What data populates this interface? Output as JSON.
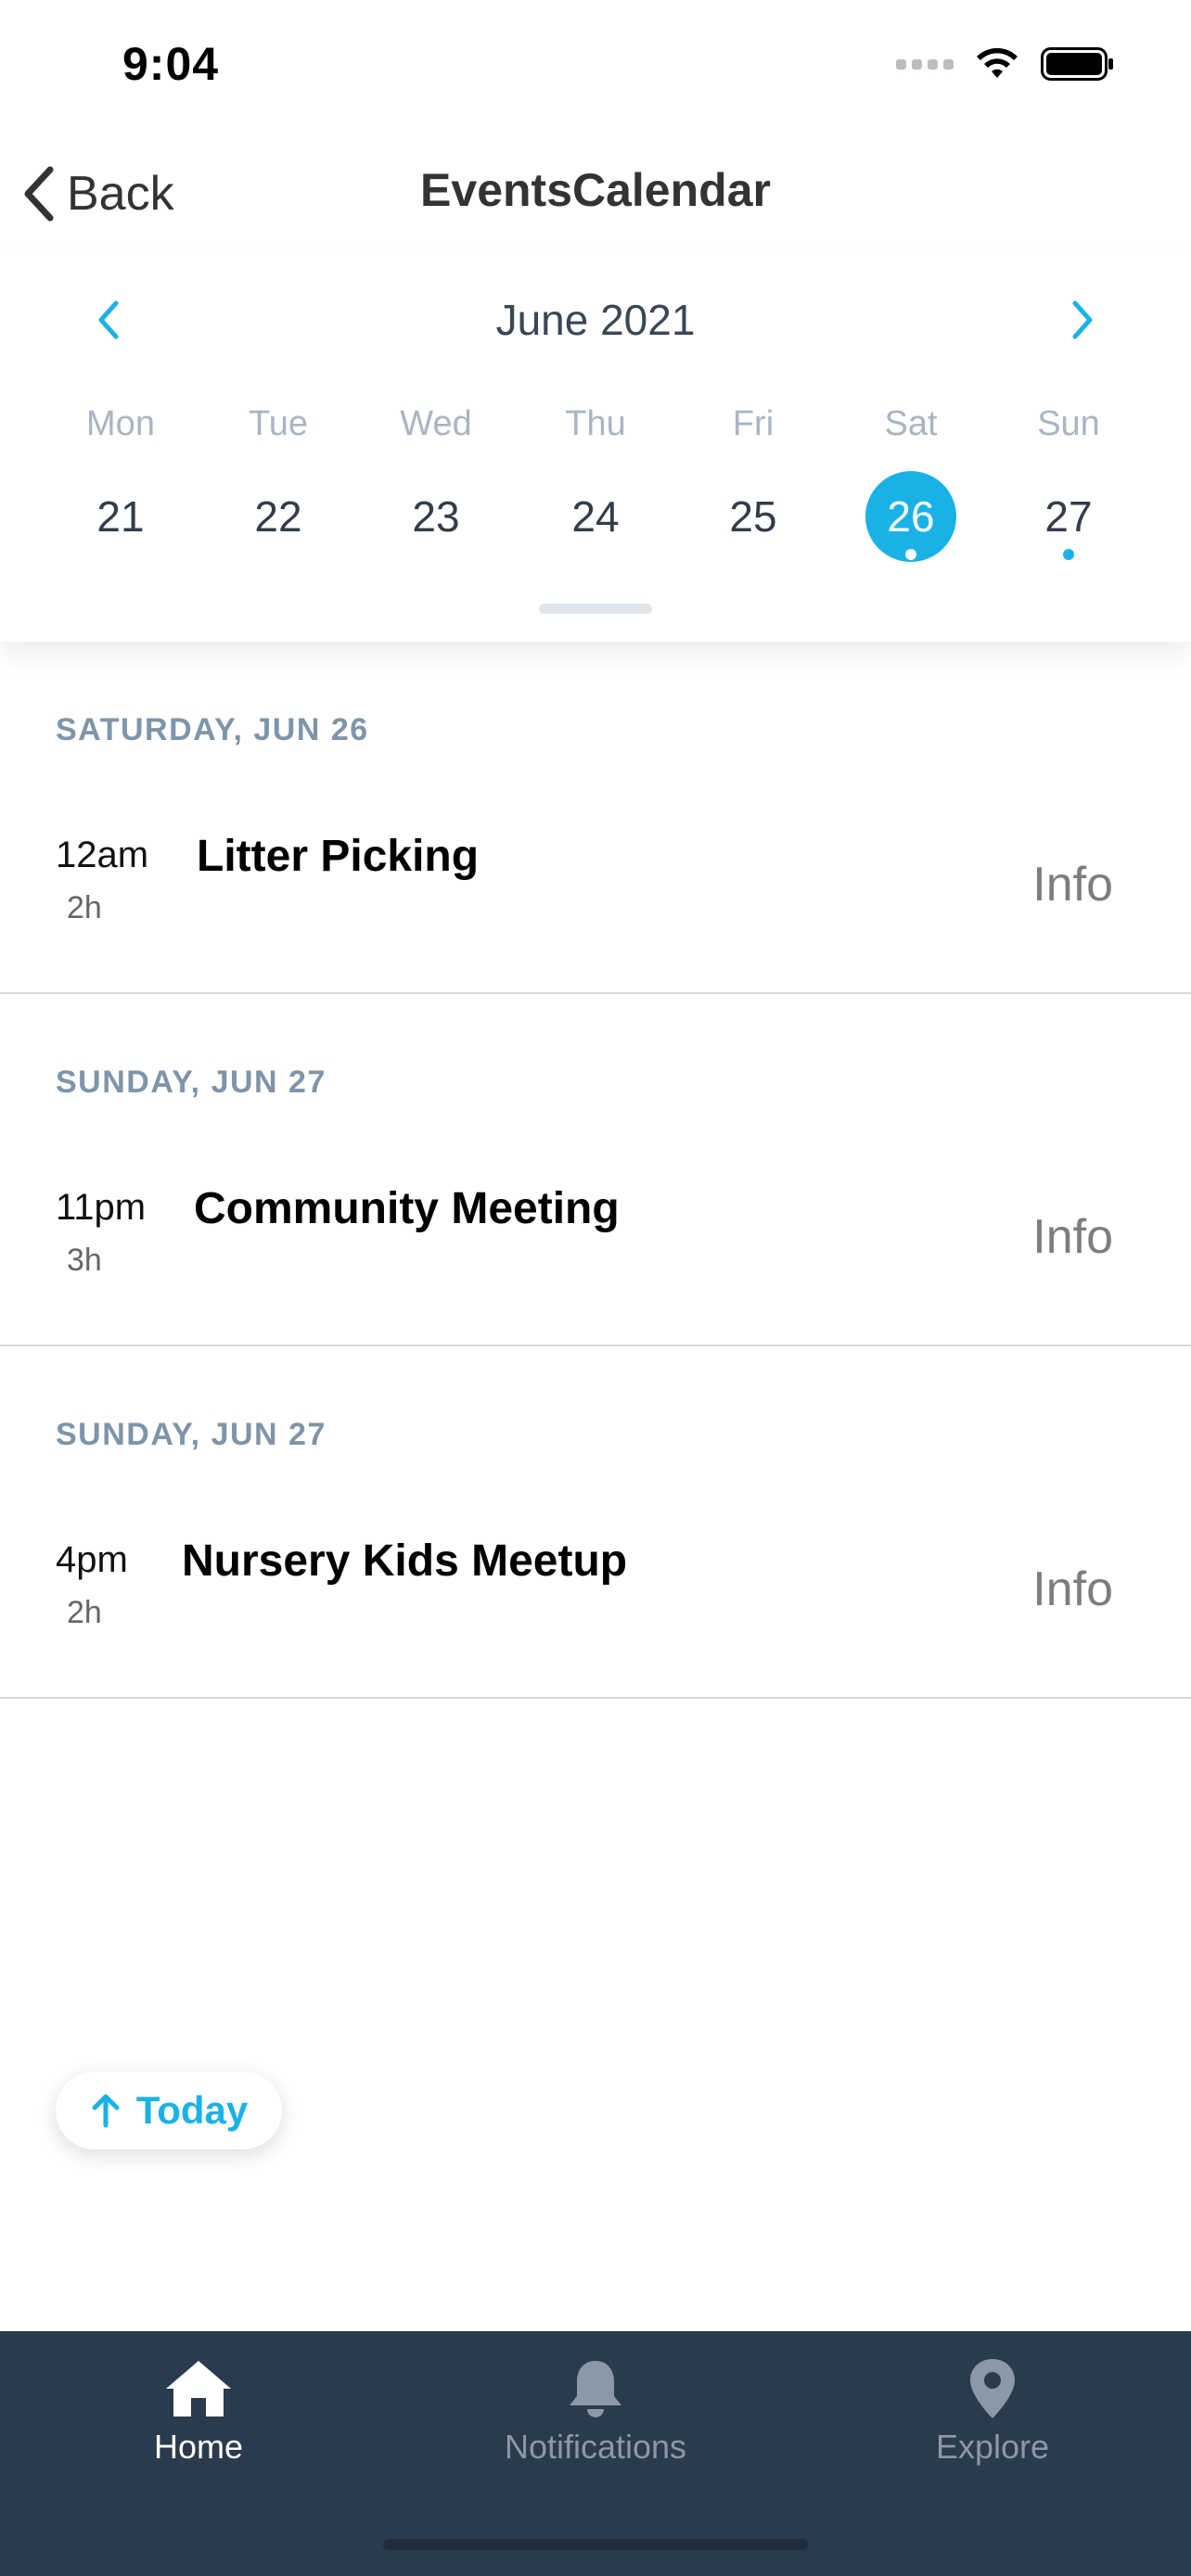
{
  "status_bar": {
    "time": "9:04",
    "icons": [
      "cellular-signal-icon",
      "wifi-icon",
      "battery-icon"
    ]
  },
  "nav": {
    "back_label": "Back",
    "back_icon": "chevron-left-icon",
    "title": "EventsCalendar"
  },
  "calendar": {
    "month_label": "June 2021",
    "prev_icon": "chevron-left-icon",
    "next_icon": "chevron-right-icon",
    "accent_color": "#1ab2e6",
    "weekdays": [
      "Mon",
      "Tue",
      "Wed",
      "Thu",
      "Fri",
      "Sat",
      "Sun"
    ],
    "days": [
      {
        "label": "21",
        "selected": false,
        "has_event": false
      },
      {
        "label": "22",
        "selected": false,
        "has_event": false
      },
      {
        "label": "23",
        "selected": false,
        "has_event": false
      },
      {
        "label": "24",
        "selected": false,
        "has_event": false
      },
      {
        "label": "25",
        "selected": false,
        "has_event": false
      },
      {
        "label": "26",
        "selected": true,
        "has_event": true
      },
      {
        "label": "27",
        "selected": false,
        "has_event": true
      }
    ]
  },
  "events": [
    {
      "date_header": "SATURDAY, JUN 26",
      "time": "12am",
      "duration": "2h",
      "title": "Litter Picking",
      "action": "Info"
    },
    {
      "date_header": "SUNDAY, JUN 27",
      "time": "11pm",
      "duration": "3h",
      "title": "Community Meeting",
      "action": "Info"
    },
    {
      "date_header": "SUNDAY, JUN 27",
      "time": "4pm",
      "duration": "2h",
      "title": "Nursery Kids Meetup",
      "action": "Info"
    }
  ],
  "today_button": {
    "label": "Today",
    "icon": "arrow-up-icon"
  },
  "tab_bar": {
    "background_color": "#2a3b4d",
    "tabs": [
      {
        "label": "Home",
        "icon": "home-icon",
        "active": true
      },
      {
        "label": "Notifications",
        "icon": "bell-icon",
        "active": false
      },
      {
        "label": "Explore",
        "icon": "map-pin-icon",
        "active": false
      }
    ]
  }
}
